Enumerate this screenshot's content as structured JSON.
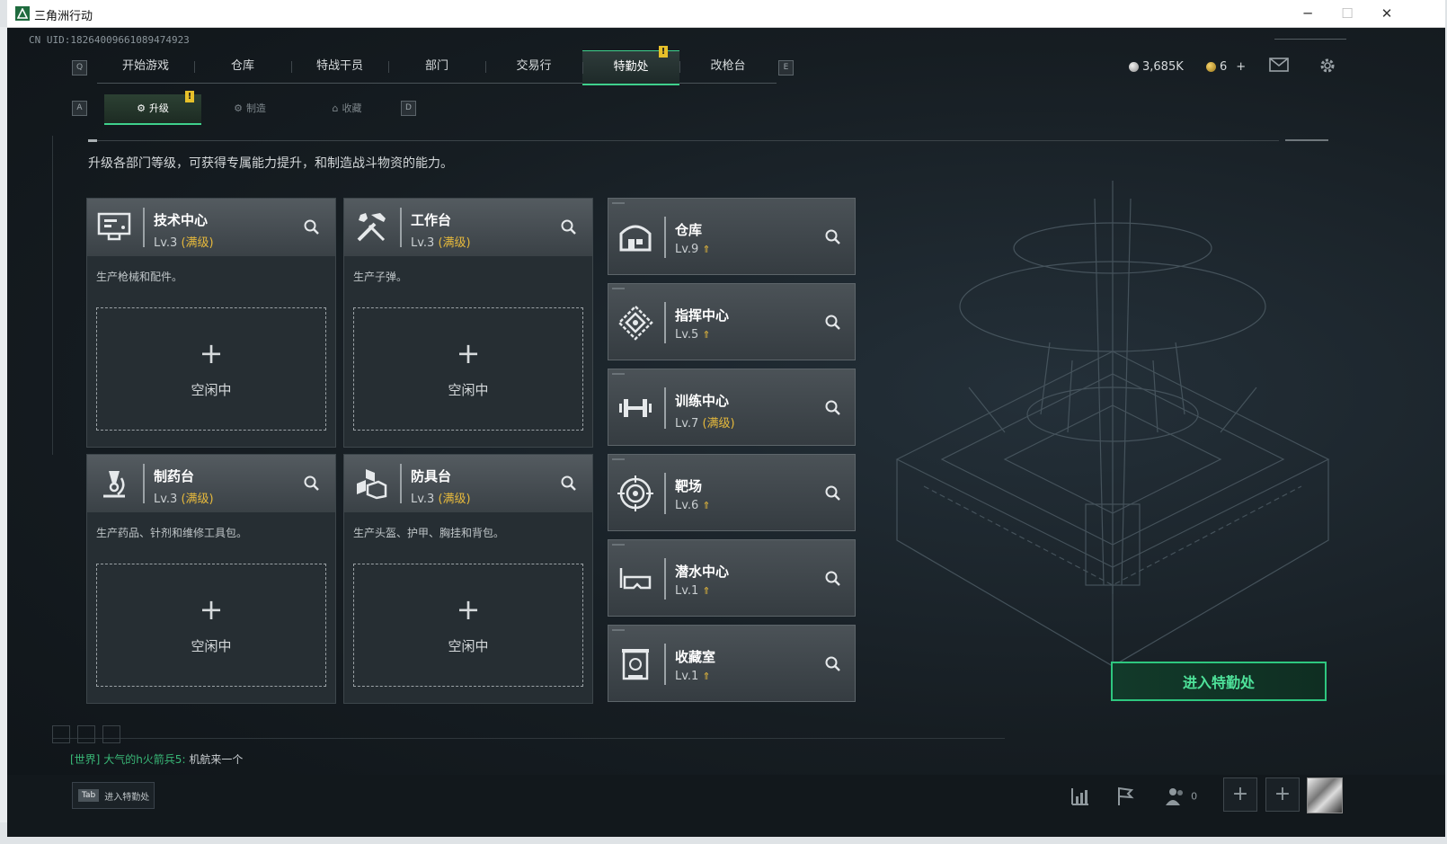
{
  "window": {
    "title": "三角洲行动",
    "minimize_icon": "─",
    "maximize_icon": "☐",
    "close_icon": "✕"
  },
  "uid": "CN UID:18264009661089474923",
  "top_nav": {
    "left_key": "Q",
    "right_key": "E",
    "tabs": [
      {
        "label": "开始游戏"
      },
      {
        "label": "仓库"
      },
      {
        "label": "特战干员"
      },
      {
        "label": "部门"
      },
      {
        "label": "交易行"
      },
      {
        "label": "特勤处",
        "active": true
      },
      {
        "label": "改枪台"
      }
    ],
    "alert": "!"
  },
  "currency": {
    "silver": "3,685K",
    "gold": "6",
    "gold_add": "+"
  },
  "sub_nav": {
    "left_key": "A",
    "right_key": "D",
    "tabs": [
      {
        "label": "升级",
        "active": true
      },
      {
        "label": "制造"
      },
      {
        "label": "收藏"
      }
    ],
    "alert": "!"
  },
  "description": "升级各部门等级，可获得专属能力提升，和制造战斗物资的能力。",
  "production_cards": [
    {
      "name": "技术中心",
      "level": "Lv.3",
      "max_label": "(满级)",
      "text": "生产枪械和配件。",
      "slot_plus": "+",
      "slot_status": "空闲中",
      "icon": "computer-icon"
    },
    {
      "name": "工作台",
      "level": "Lv.3",
      "max_label": "(满级)",
      "text": "生产子弹。",
      "slot_plus": "+",
      "slot_status": "空闲中",
      "icon": "tools-icon"
    },
    {
      "name": "制药台",
      "level": "Lv.3",
      "max_label": "(满级)",
      "text": "生产药品、针剂和维修工具包。",
      "slot_plus": "+",
      "slot_status": "空闲中",
      "icon": "microscope-icon"
    },
    {
      "name": "防具台",
      "level": "Lv.3",
      "max_label": "(满级)",
      "text": "生产头盔、护甲、胸挂和背包。",
      "slot_plus": "+",
      "slot_status": "空闲中",
      "icon": "armor-crates-icon"
    }
  ],
  "facilities": [
    {
      "name": "仓库",
      "level": "Lv.9",
      "max_label": "",
      "upgrade": "⇑",
      "icon": "warehouse-icon"
    },
    {
      "name": "指挥中心",
      "level": "Lv.5",
      "max_label": "",
      "upgrade": "⇑",
      "icon": "command-icon"
    },
    {
      "name": "训练中心",
      "level": "Lv.7",
      "max_label": "(满级)",
      "upgrade": "",
      "icon": "dumbbell-icon"
    },
    {
      "name": "靶场",
      "level": "Lv.6",
      "max_label": "",
      "upgrade": "⇑",
      "icon": "target-icon"
    },
    {
      "name": "潜水中心",
      "level": "Lv.1",
      "max_label": "",
      "upgrade": "⇑",
      "icon": "diving-mask-icon"
    },
    {
      "name": "收藏室",
      "level": "Lv.1",
      "max_label": "",
      "upgrade": "⇑",
      "icon": "display-case-icon"
    }
  ],
  "enter_button": "进入特勤处",
  "chat": {
    "channel": "[世界]",
    "sender": "大气的h火箭兵5:",
    "message": "机航来一个"
  },
  "bottom": {
    "tab_key": "Tab",
    "tab_label": "进入特勤处",
    "friends_count": "0",
    "add_label": "+"
  },
  "colors": {
    "accent": "#3fd08c",
    "max_level": "#e6b93c",
    "alert": "#e6c02a",
    "background": "#161d22"
  }
}
